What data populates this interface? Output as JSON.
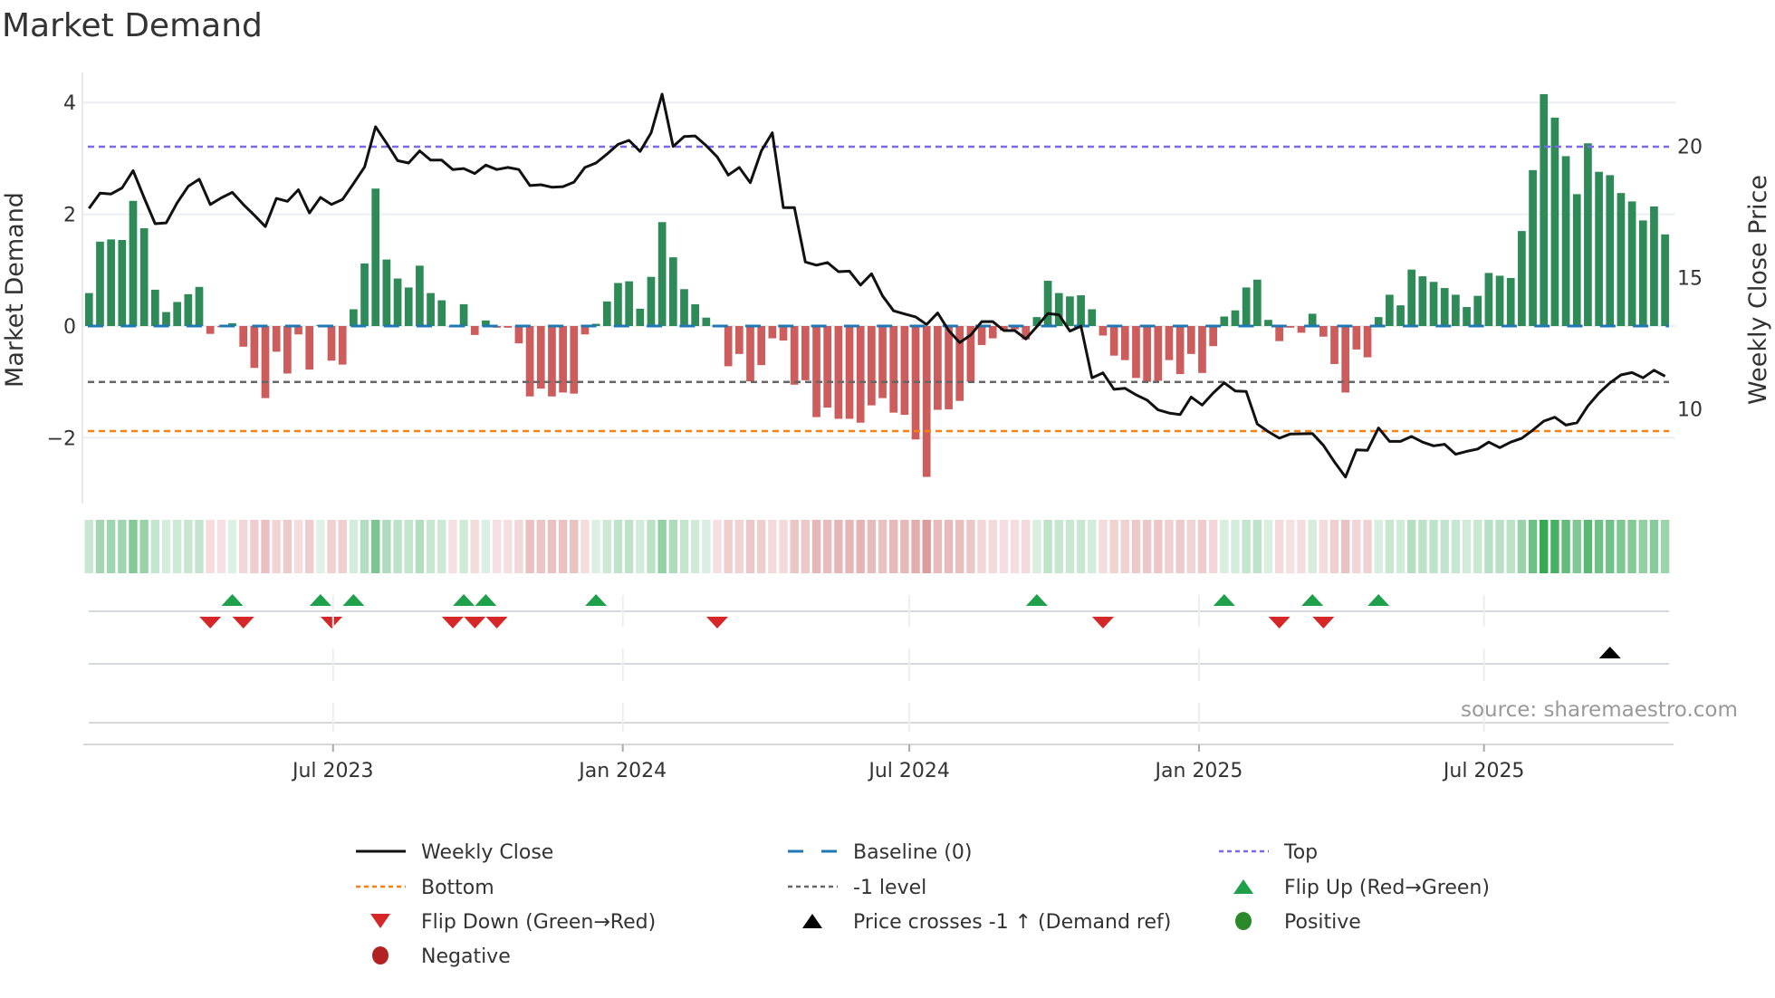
{
  "title": "Market Demand",
  "source": "source: sharemaestro.com",
  "colors": {
    "green_bar": "#2e8b57",
    "red_bar": "#cd5c5c",
    "price": "#111111",
    "baseline": "#1f77b4",
    "top": "#7b68ee",
    "bottom": "#ff7f0e",
    "minus1": "#666666",
    "flip_up": "#1fa04a",
    "flip_down": "#d62728",
    "cross": "#000000",
    "positive": "#2a8a2a",
    "negative": "#b22222"
  },
  "chart_data": {
    "type": "bar",
    "title": "Market Demand",
    "ylabel": "Market Demand",
    "y2label": "Weekly Close Price",
    "x_start": "2023-01-27",
    "x_step_days": 7,
    "ylim": [
      -3.18,
      4.5
    ],
    "y2lim": [
      6.4,
      22.75
    ],
    "yticks": [
      {
        "v": 4,
        "label": "4"
      },
      {
        "v": 2,
        "label": "2"
      },
      {
        "v": 0,
        "label": "0"
      },
      {
        "v": -2,
        "label": "−2"
      }
    ],
    "y2ticks": [
      {
        "v": 20,
        "label": "20"
      },
      {
        "v": 15,
        "label": "15"
      },
      {
        "v": 10,
        "label": "10"
      }
    ],
    "xticks": [
      {
        "date": "2023-07-01",
        "label": "Jul 2023"
      },
      {
        "date": "2024-01-01",
        "label": "Jan 2024"
      },
      {
        "date": "2024-07-01",
        "label": "Jul 2024"
      },
      {
        "date": "2025-01-01",
        "label": "Jan 2025"
      },
      {
        "date": "2025-07-01",
        "label": "Jul 2025"
      }
    ],
    "levels": {
      "top": 3.21,
      "bottom": -1.88,
      "minus1": -1.0,
      "baseline": 0
    },
    "demand": [
      0.59,
      1.51,
      1.55,
      1.54,
      2.24,
      1.75,
      0.65,
      0.25,
      0.43,
      0.57,
      0.7,
      -0.14,
      -0.02,
      0.05,
      -0.37,
      -0.75,
      -1.29,
      -0.46,
      -0.85,
      -0.15,
      -0.78,
      0.02,
      -0.62,
      -0.69,
      0.3,
      1.12,
      2.46,
      1.19,
      0.85,
      0.69,
      1.08,
      0.59,
      0.46,
      -0.02,
      0.39,
      -0.16,
      0.1,
      -0.03,
      -0.03,
      -0.31,
      -1.26,
      -1.12,
      -1.26,
      -1.19,
      -1.21,
      -0.15,
      0.04,
      0.44,
      0.77,
      0.8,
      0.31,
      0.88,
      1.86,
      1.23,
      0.66,
      0.39,
      0.15,
      -0.02,
      -0.72,
      -0.5,
      -0.99,
      -0.7,
      -0.22,
      -0.26,
      -1.05,
      -0.97,
      -1.63,
      -1.46,
      -1.66,
      -1.66,
      -1.73,
      -1.42,
      -1.29,
      -1.55,
      -1.59,
      -2.03,
      -2.7,
      -1.5,
      -1.49,
      -1.34,
      -1.0,
      -0.34,
      -0.22,
      -0.08,
      -0.06,
      -0.24,
      0.16,
      0.81,
      0.59,
      0.53,
      0.55,
      0.3,
      -0.17,
      -0.53,
      -0.61,
      -0.93,
      -1.0,
      -0.98,
      -0.61,
      -0.86,
      -0.5,
      -0.84,
      -0.36,
      0.17,
      0.28,
      0.69,
      0.83,
      0.11,
      -0.27,
      -0.03,
      -0.12,
      0.22,
      -0.19,
      -0.68,
      -1.19,
      -0.42,
      -0.56,
      0.16,
      0.56,
      0.37,
      1.01,
      0.89,
      0.79,
      0.68,
      0.56,
      0.34,
      0.54,
      0.95,
      0.9,
      0.86,
      1.7,
      2.79,
      4.15,
      3.73,
      3.04,
      2.36,
      3.27,
      2.76,
      2.7,
      2.38,
      2.23,
      1.89,
      2.14,
      1.64
    ],
    "weekly_close": [
      17.64,
      18.22,
      18.19,
      18.42,
      19.08,
      18.04,
      17.06,
      17.09,
      17.86,
      18.48,
      18.75,
      17.79,
      18.04,
      18.25,
      17.79,
      17.38,
      16.95,
      18.02,
      17.91,
      18.35,
      17.47,
      18.06,
      17.79,
      17.98,
      18.59,
      19.22,
      20.75,
      20.12,
      19.46,
      19.37,
      19.83,
      19.48,
      19.48,
      19.12,
      19.16,
      18.97,
      19.29,
      19.12,
      19.2,
      19.12,
      18.51,
      18.54,
      18.45,
      18.47,
      18.64,
      19.2,
      19.37,
      19.71,
      20.08,
      20.23,
      19.81,
      20.52,
      21.99,
      20.0,
      20.38,
      20.4,
      20.03,
      19.6,
      18.91,
      19.2,
      18.62,
      19.83,
      20.52,
      17.67,
      17.67,
      15.6,
      15.48,
      15.58,
      15.23,
      15.25,
      14.72,
      15.15,
      14.31,
      13.74,
      13.62,
      13.51,
      13.22,
      13.66,
      12.99,
      12.53,
      12.82,
      13.33,
      13.33,
      12.99,
      12.99,
      12.67,
      13.14,
      13.64,
      13.59,
      12.97,
      13.16,
      11.19,
      11.38,
      10.75,
      10.79,
      10.54,
      10.34,
      9.97,
      9.85,
      9.79,
      10.46,
      10.15,
      10.61,
      11.0,
      10.69,
      10.67,
      9.43,
      9.14,
      8.89,
      9.05,
      9.06,
      9.07,
      8.62,
      7.99,
      7.41,
      8.45,
      8.43,
      9.28,
      8.77,
      8.77,
      8.96,
      8.74,
      8.6,
      8.66,
      8.28,
      8.39,
      8.48,
      8.74,
      8.53,
      8.74,
      8.89,
      9.2,
      9.54,
      9.69,
      9.39,
      9.48,
      10.12,
      10.61,
      11.0,
      11.3,
      11.39,
      11.19,
      11.48,
      11.25
    ],
    "flip_up_weeks": [
      13,
      21,
      24,
      34,
      36,
      46,
      86,
      103,
      111,
      117
    ],
    "flip_down_weeks": [
      11,
      14,
      22,
      33,
      35,
      37,
      57,
      92,
      108,
      112
    ],
    "price_cross_weeks": [
      138
    ],
    "legend": [
      {
        "key": "weekly_close",
        "label": "Weekly Close"
      },
      {
        "key": "baseline",
        "label": "Baseline (0)"
      },
      {
        "key": "top",
        "label": "Top"
      },
      {
        "key": "bottom",
        "label": "Bottom"
      },
      {
        "key": "minus1",
        "label": "-1 level"
      },
      {
        "key": "flip_up",
        "label": "Flip Up (Red→Green)"
      },
      {
        "key": "flip_down",
        "label": "Flip Down (Green→Red)"
      },
      {
        "key": "cross",
        "label": "Price crosses -1 ↑ (Demand ref)"
      },
      {
        "key": "positive",
        "label": "Positive"
      },
      {
        "key": "negative",
        "label": "Negative"
      }
    ],
    "legend_position": "bottom"
  }
}
